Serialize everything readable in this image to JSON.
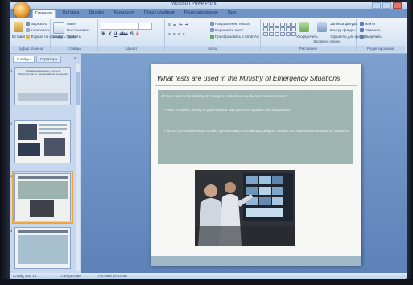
{
  "window": {
    "title": "Microsoft PowerPoint"
  },
  "ribbon": {
    "tabs": [
      "Главная",
      "Вставка",
      "Дизайн",
      "Анимация",
      "Показ слайдов",
      "Рецензирование",
      "Вид"
    ],
    "active_tab": "Главная",
    "clipboard": {
      "paste": "Вставить",
      "cut": "Вырезать",
      "copy": "Копировать",
      "format": "Формат по образцу",
      "label": "Буфер обмена"
    },
    "slides": {
      "create": "Создать слайд",
      "layout": "Макет",
      "reset": "Восстановить",
      "delete": "Удалить",
      "label": "Слайды"
    },
    "font": {
      "name": "",
      "size": "",
      "label": "Шрифт"
    },
    "paragraph": {
      "direction": "Направление текста",
      "align": "Выровнять текст",
      "smartart": "Преобразовать в SmartArt",
      "label": "Абзац"
    },
    "drawing": {
      "arrange": "Упорядочить",
      "styles": "Экспресс-стили",
      "fill": "Заливка фигуры",
      "outline": "Контур фигуры",
      "effects": "Эффекты для фигур",
      "label": "Рисование"
    },
    "editing": {
      "find": "Найти",
      "replace": "Заменить",
      "select": "Выделить",
      "label": "Редактирование"
    }
  },
  "panel": {
    "tabs": [
      "Слайды",
      "Структура"
    ],
    "active_tab": "Слайды",
    "thumbnails": [
      {
        "num": "1",
        "text": "Суммарные вопросы о тесте в Министерстве по чрезвычайным ситуациям"
      },
      {
        "num": "2",
        "text": ""
      },
      {
        "num": "3",
        "text": ""
      },
      {
        "num": "4",
        "text": ""
      }
    ],
    "selected_index": 2
  },
  "slide": {
    "title": "What tests are used in the Ministry of Emergency Situations",
    "body_intro": "All tests used in the Ministry of Emergency Situations are divided into two formats:",
    "bullets": [
      "SMIL (complex) testing of psychological state, personal qualities and dispositions",
      "MLOC (the multi-level personality questionnaire) for evaluating adaptive abilities and readiness to emergency situations"
    ]
  },
  "statusbar": {
    "slide_info": "Слайд 3 из 12",
    "theme": "\"Стандартная\"",
    "language": "Русский (Россия)"
  }
}
